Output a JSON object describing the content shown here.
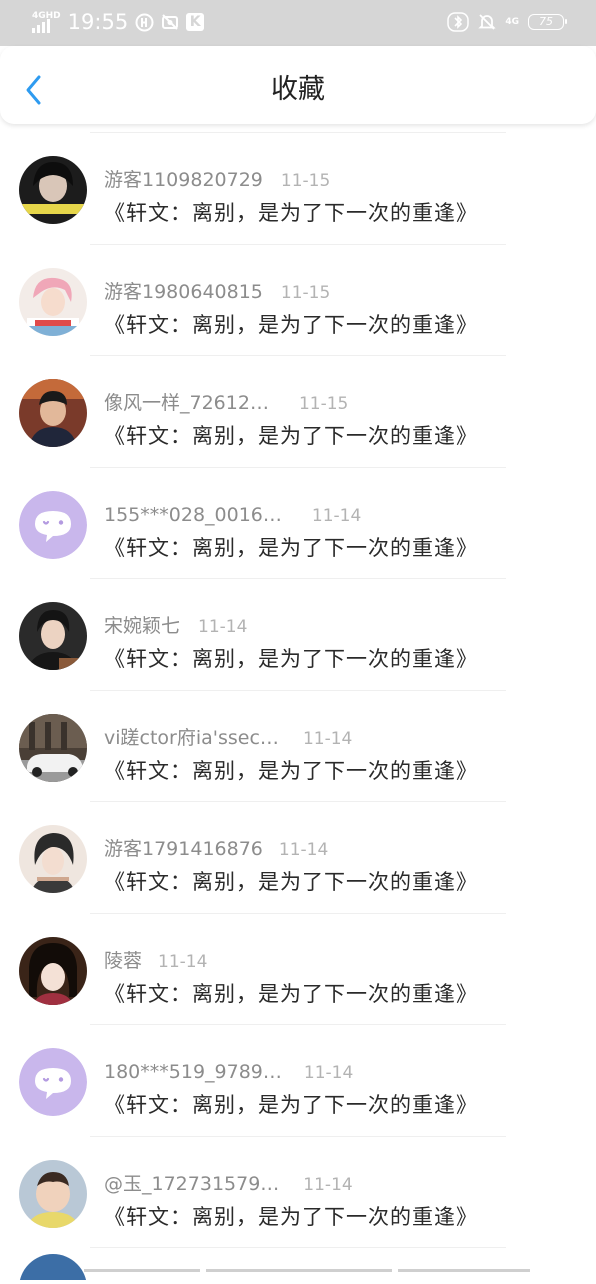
{
  "status_bar": {
    "network_label": "4GHD",
    "time": "19:55",
    "k_badge": "K",
    "right_network": "4G",
    "battery": "75",
    "icons": [
      "hd-icon",
      "no-photo-icon",
      "k-app-icon",
      "bluetooth-icon",
      "mute-icon",
      "battery-icon"
    ]
  },
  "header": {
    "title": "收藏",
    "back_icon": "chevron-left-icon",
    "accent": "#2e9bf0"
  },
  "favorites": [
    {
      "username": "游客1109820729",
      "date": "11-15",
      "content": "《轩文：离别，是为了下一次的重逢》",
      "avatar": "photo-dark-girl"
    },
    {
      "username": "游客1980640815",
      "date": "11-15",
      "content": "《轩文：离别，是为了下一次的重逢》",
      "avatar": "photo-pink-hair"
    },
    {
      "username": "像风一样_72612…",
      "date": "11-15",
      "content": "《轩文：离别，是为了下一次的重逢》",
      "avatar": "photo-man"
    },
    {
      "username": "155***028_0016…",
      "date": "11-14",
      "content": "《轩文：离别，是为了下一次的重逢》",
      "avatar": "default-chat-avatar"
    },
    {
      "username": "宋婉颖七",
      "date": "11-14",
      "content": "《轩文：离别，是为了下一次的重逢》",
      "avatar": "photo-boy"
    },
    {
      "username": "vi蹉ctor府ia'ssec…",
      "date": "11-14",
      "content": "《轩文：离别，是为了下一次的重逢》",
      "avatar": "photo-car"
    },
    {
      "username": "游客1791416876",
      "date": "11-14",
      "content": "《轩文：离别，是为了下一次的重逢》",
      "avatar": "photo-anime-girl"
    },
    {
      "username": "陵蓉",
      "date": "11-14",
      "content": "《轩文：离别，是为了下一次的重逢》",
      "avatar": "photo-costume-girl"
    },
    {
      "username": "180***519_9789…",
      "date": "11-14",
      "content": "《轩文：离别，是为了下一次的重逢》",
      "avatar": "default-chat-avatar"
    },
    {
      "username": "@玉_172731579…",
      "date": "11-14",
      "content": "《轩文：离别，是为了下一次的重逢》",
      "avatar": "photo-baby"
    }
  ]
}
